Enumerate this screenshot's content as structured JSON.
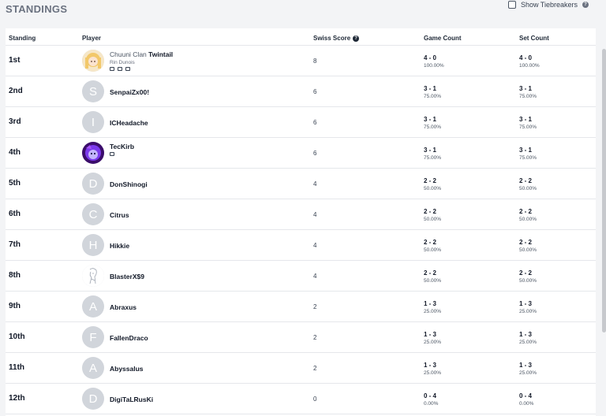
{
  "header": {
    "title": "STANDINGS",
    "tiebreaker_label": "Show Tiebreakers",
    "help_glyph": "?"
  },
  "columns": {
    "standing": "Standing",
    "player": "Player",
    "swiss": "Swiss Score",
    "game": "Game Count",
    "set": "Set Count"
  },
  "rows": [
    {
      "rank": "1st",
      "prefix": "Chuuni Clan",
      "name": "Twintail",
      "sub": "Rin Dunois",
      "avatar": "image-anime-blonde",
      "swiss": "8",
      "game": "4 - 0",
      "game_pct": "100.00%",
      "set": "4 - 0",
      "set_pct": "100.00%"
    },
    {
      "rank": "2nd",
      "name": "SenpaiZx00!",
      "initial": "S",
      "swiss": "6",
      "game": "3 - 1",
      "game_pct": "75.00%",
      "set": "3 - 1",
      "set_pct": "75.00%"
    },
    {
      "rank": "3rd",
      "name": "ICHeadache",
      "initial": "I",
      "swiss": "6",
      "game": "3 - 1",
      "game_pct": "75.00%",
      "set": "3 - 1",
      "set_pct": "75.00%"
    },
    {
      "rank": "4th",
      "name": "TecKirb",
      "avatar": "image-purple-character",
      "swiss": "6",
      "game": "3 - 1",
      "game_pct": "75.00%",
      "set": "3 - 1",
      "set_pct": "75.00%"
    },
    {
      "rank": "5th",
      "name": "DonShinogi",
      "initial": "D",
      "swiss": "4",
      "game": "2 - 2",
      "game_pct": "50.00%",
      "set": "2 - 2",
      "set_pct": "50.00%"
    },
    {
      "rank": "6th",
      "name": "Citrus",
      "initial": "C",
      "swiss": "4",
      "game": "2 - 2",
      "game_pct": "50.00%",
      "set": "2 - 2",
      "set_pct": "50.00%"
    },
    {
      "rank": "7th",
      "name": "Hikkie",
      "initial": "H",
      "swiss": "4",
      "game": "2 - 2",
      "game_pct": "50.00%",
      "set": "2 - 2",
      "set_pct": "50.00%"
    },
    {
      "rank": "8th",
      "name": "BlasterX$9",
      "avatar": "image-sketch",
      "swiss": "4",
      "game": "2 - 2",
      "game_pct": "50.00%",
      "set": "2 - 2",
      "set_pct": "50.00%"
    },
    {
      "rank": "9th",
      "name": "Abraxus",
      "initial": "A",
      "swiss": "2",
      "game": "1 - 3",
      "game_pct": "25.00%",
      "set": "1 - 3",
      "set_pct": "25.00%"
    },
    {
      "rank": "10th",
      "name": "FallenDraco",
      "initial": "F",
      "swiss": "2",
      "game": "1 - 3",
      "game_pct": "25.00%",
      "set": "1 - 3",
      "set_pct": "25.00%"
    },
    {
      "rank": "11th",
      "name": "Abyssalus",
      "initial": "A",
      "swiss": "2",
      "game": "1 - 3",
      "game_pct": "25.00%",
      "set": "1 - 3",
      "set_pct": "25.00%"
    },
    {
      "rank": "12th",
      "name": "DigiTaLRusKi",
      "initial": "D",
      "swiss": "0",
      "game": "0 - 4",
      "game_pct": "0.00%",
      "set": "0 - 4",
      "set_pct": "0.00%"
    }
  ]
}
